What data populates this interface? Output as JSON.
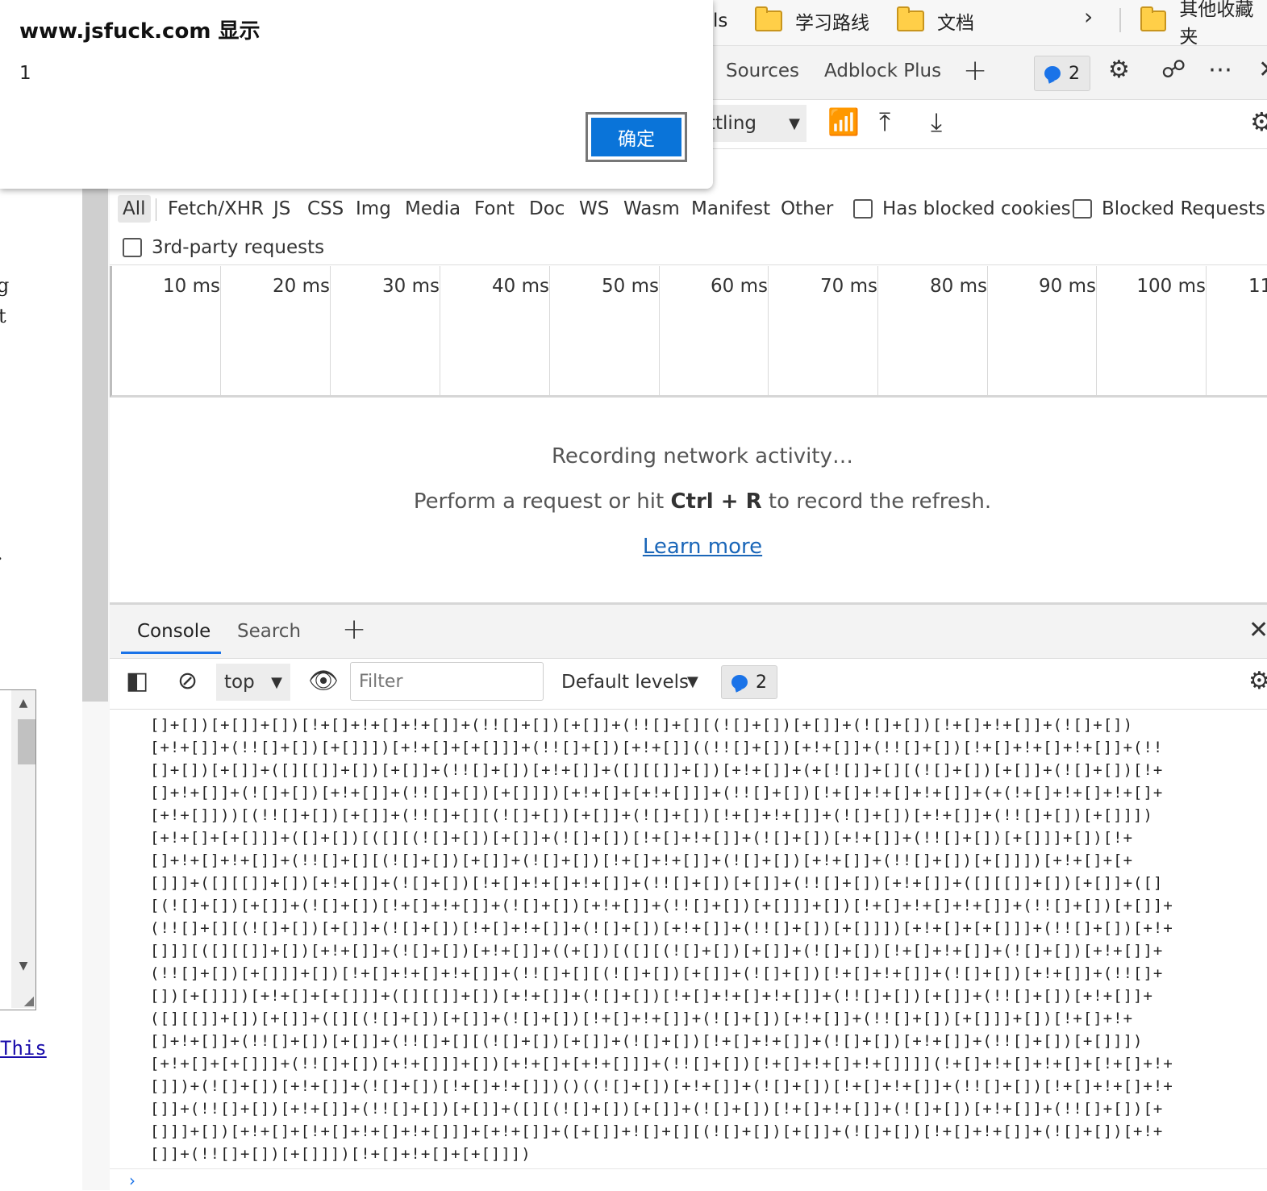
{
  "page": {
    "fragments": [
      "g",
      "t",
      "."
    ],
    "link_text": "This"
  },
  "alert": {
    "title": "www.jsfuck.com 显示",
    "message": "1",
    "ok_label": "确定"
  },
  "bookmarks": {
    "partial": "ls",
    "items": [
      "学习路线",
      "文档",
      "其他收藏夹"
    ],
    "chevron": "›"
  },
  "devtools": {
    "tabs": [
      "Sources",
      "Adblock Plus"
    ],
    "issues_count": "2",
    "throttling_label": "ttling"
  },
  "network": {
    "type_filters": [
      "All",
      "Fetch/XHR",
      "JS",
      "CSS",
      "Img",
      "Media",
      "Font",
      "Doc",
      "WS",
      "Wasm",
      "Manifest",
      "Other"
    ],
    "active_filter": "All",
    "checkboxes": {
      "blocked_cookies": "Has blocked cookies",
      "blocked_requests": "Blocked Requests",
      "third_party": "3rd-party requests"
    },
    "timeline_ticks": [
      "10 ms",
      "20 ms",
      "30 ms",
      "40 ms",
      "50 ms",
      "60 ms",
      "70 ms",
      "80 ms",
      "90 ms",
      "100 ms",
      "11"
    ],
    "recording_title": "Recording network activity…",
    "hint_before": "Perform a request or hit ",
    "hint_keys": "Ctrl + R",
    "hint_after": " to record the refresh.",
    "learn_more": "Learn more"
  },
  "drawer": {
    "tabs": [
      "Console",
      "Search"
    ],
    "active_tab": "Console"
  },
  "console": {
    "context": "top",
    "filter_placeholder": "Filter",
    "levels": "Default levels",
    "issues_count": "2",
    "output_lines": [
      "[]+[])[+[]]+[])[!+[]+!+[]+!+[]]+(!![]+[])[+[]]+(!![]+[][(![]+[])[+[]]+(![]+[])[!+[]+!+[]]+(![]+[])",
      "[+!+[]]+(!![]+[])[+[]]])[+!+[]+[+[]]]+(!![]+[])[+!+[]]((!![]+[])[+!+[]]+(!![]+[])[!+[]+!+[]+!+[]]+(!!",
      "[]+[])[+[]]+([][[]]+[])[+[]]+(!![]+[])[+!+[]]+([][[]]+[])[+!+[]]+(+[![]]+[][(![]+[])[+[]]+(![]+[])[!+",
      "[]+!+[]]+(![]+[])[+!+[]]+(!![]+[])[+[]]])[+!+[]+[+!+[]]]+(!![]+[])[!+[]+!+[]+!+[]]+(+(!+[]+!+[]+!+[]+",
      "[+!+[]]))[(!![]+[])[+[]]+(!![]+[][(![]+[])[+[]]+(![]+[])[!+[]+!+[]]+(![]+[])[+!+[]]+(!![]+[])[+[]]])",
      "[+!+[]+[+[]]]+([]+[])[([][(![]+[])[+[]]+(![]+[])[!+[]+!+[]]+(![]+[])[+!+[]]+(!![]+[])[+[]]]+[])[!+",
      "[]+!+[]+!+[]]+(!![]+[][(![]+[])[+[]]+(![]+[])[!+[]+!+[]]+(![]+[])[+!+[]]+(!![]+[])[+[]]])[+!+[]+[+",
      "[]]]+([][[]]+[])[+!+[]]+(![]+[])[!+[]+!+[]+!+[]]+(!![]+[])[+[]]+(!![]+[])[+!+[]]+([][[]]+[])[+[]]+([]",
      "[(![]+[])[+[]]+(![]+[])[!+[]+!+[]]+(![]+[])[+!+[]]+(!![]+[])[+[]]]+[])[!+[]+!+[]+!+[]]+(!![]+[])[+[]]+",
      "(!![]+[][(![]+[])[+[]]+(![]+[])[!+[]+!+[]]+(![]+[])[+!+[]]+(!![]+[])[+[]]])[+!+[]+[+[]]]+(!![]+[])[+!+",
      "[]]][([][[]]+[])[+!+[]]+(![]+[])[+!+[]]+((+[])[([][(![]+[])[+[]]+(![]+[])[!+[]+!+[]]+(![]+[])[+!+[]]+",
      "(!![]+[])[+[]]]+[])[!+[]+!+[]+!+[]]+(!![]+[][(![]+[])[+[]]+(![]+[])[!+[]+!+[]]+(![]+[])[+!+[]]+(!![]+",
      "[])[+[]]])[+!+[]+[+[]]]+([][[]]+[])[+!+[]]+(![]+[])[!+[]+!+[]+!+[]]+(!![]+[])[+[]]+(!![]+[])[+!+[]]+",
      "([][[]]+[])[+[]]+([][(![]+[])[+[]]+(![]+[])[!+[]+!+[]]+(![]+[])[+!+[]]+(!![]+[])[+[]]]+[])[!+[]+!+",
      "[]+!+[]]+(!![]+[])[+[]]+(!![]+[][(![]+[])[+[]]+(![]+[])[!+[]+!+[]]+(![]+[])[+!+[]]+(!![]+[])[+[]]])",
      "[+!+[]+[+[]]]+(!![]+[])[+!+[]]]+[])[+!+[]+[+!+[]]]+(!![]+[])[!+[]+!+[]+!+[]]]](!+[]+!+[]+!+[]+[!+[]+!+",
      "[]])+(![]+[])[+!+[]]+(![]+[])[!+[]+!+[]])()((![]+[])[+!+[]]+(![]+[])[!+[]+!+[]]+(!![]+[])[!+[]+!+[]+!+",
      "[]]+(!![]+[])[+!+[]]+(!![]+[])[+[]]+([][(![]+[])[+[]]+(![]+[])[!+[]+!+[]]+(![]+[])[+!+[]]+(!![]+[])[+",
      "[]]]+[])[+!+[]+[!+[]+!+[]+!+[]]]+[+!+[]]+([+[]]+![]+[][(![]+[])[+[]]+(![]+[])[!+[]+!+[]]+(![]+[])[+!+",
      "[]]+(!![]+[])[+[]]])[!+[]+!+[]+[+[]]])"
    ]
  }
}
